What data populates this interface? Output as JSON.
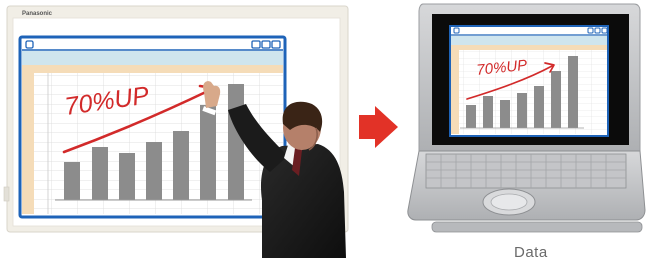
{
  "board": {
    "brand": "Panasonic",
    "fine_print": "",
    "model": "",
    "annotation": "70%UP"
  },
  "laptop": {
    "annotation": "70%UP",
    "title_bar": ""
  },
  "caption": "Data",
  "colors": {
    "board_frame": "#f1eee6",
    "window_border": "#1e63b8",
    "title_band": "#cfe5ee",
    "row_stripe": "#f5dcb8",
    "bar": "#8c8c8c",
    "arrow": "#e23227",
    "ink": "#d22a2a"
  },
  "icons": [
    "window-icon",
    "window-controls-icon",
    "right-arrow-icon",
    "presenter-figure",
    "laptop-figure"
  ]
}
